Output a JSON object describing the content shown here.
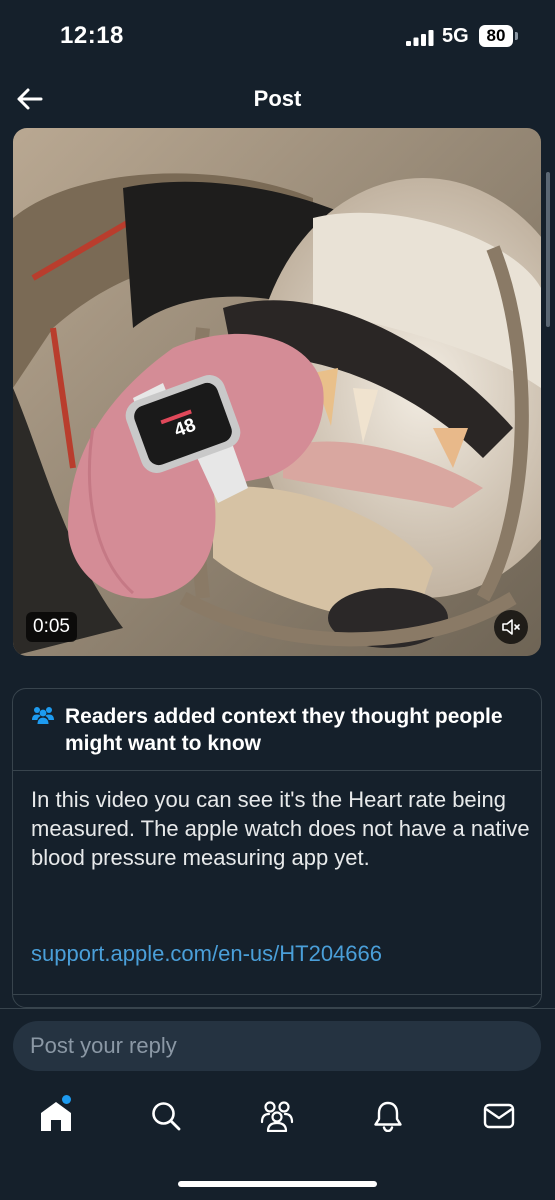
{
  "status_bar": {
    "time": "12:18",
    "network": "5G",
    "battery": "80"
  },
  "header": {
    "title": "Post"
  },
  "video": {
    "timestamp": "0:05",
    "muted": true
  },
  "community_note": {
    "title": "Readers added context they thought people might want to know",
    "body": "In this video you can see it's the Heart rate being measured. The apple watch does not have a native blood pressure measuring app yet.",
    "link": "support.apple.com/en-us/HT204666"
  },
  "reply": {
    "placeholder": "Post your reply"
  },
  "tab_bar": {
    "items": [
      {
        "icon": "home-icon",
        "active": true,
        "has_notification_dot": true
      },
      {
        "icon": "search-icon",
        "active": false
      },
      {
        "icon": "communities-icon",
        "active": false
      },
      {
        "icon": "bell-icon",
        "active": false
      },
      {
        "icon": "mail-icon",
        "active": false
      }
    ]
  },
  "colors": {
    "background": "#15202b",
    "accent": "#1d9bf0",
    "link": "#4a9fd9",
    "border": "#38444d"
  }
}
